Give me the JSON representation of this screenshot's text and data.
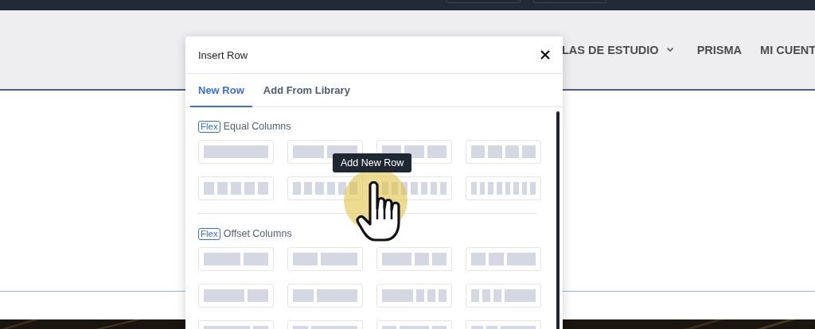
{
  "nav": [
    {
      "label": "LAS DE ESTUDIO",
      "dropdown": true
    },
    {
      "label": "PRISMA",
      "dropdown": false
    },
    {
      "label": "MI CUENT",
      "dropdown": false
    }
  ],
  "dialog": {
    "title": "Insert Row",
    "tabs": [
      {
        "label": "New Row",
        "selected": true
      },
      {
        "label": "Add From Library",
        "selected": false
      }
    ],
    "sections": [
      {
        "badge": "Flex",
        "title": "Equal Columns",
        "layouts": [
          {
            "kind": "equal-1"
          },
          {
            "kind": "equal-2"
          },
          {
            "kind": "equal-3"
          },
          {
            "kind": "equal-4"
          },
          {
            "kind": "equal-5"
          },
          {
            "kind": "equal-6"
          },
          {
            "kind": "equal-7"
          },
          {
            "kind": "equal-8"
          }
        ]
      },
      {
        "badge": "Flex",
        "title": "Offset Columns",
        "layouts": [
          {
            "kind": "wide-narrow"
          },
          {
            "kind": "narrow-wide"
          },
          {
            "kind": "wide-two-narrow"
          },
          {
            "kind": "two-narrow-wide"
          },
          {
            "kind": "wider-narrow"
          },
          {
            "kind": "narrow-wider"
          },
          {
            "kind": "wide-three-narrow"
          },
          {
            "kind": "three-narrow-wide"
          },
          {
            "kind": "widest-narrow"
          },
          {
            "kind": "narrow-widest"
          },
          {
            "kind": "narrow-wide-narrow"
          },
          {
            "kind": "two-narrow-wider"
          }
        ]
      }
    ]
  },
  "tooltip": "Add New Row"
}
